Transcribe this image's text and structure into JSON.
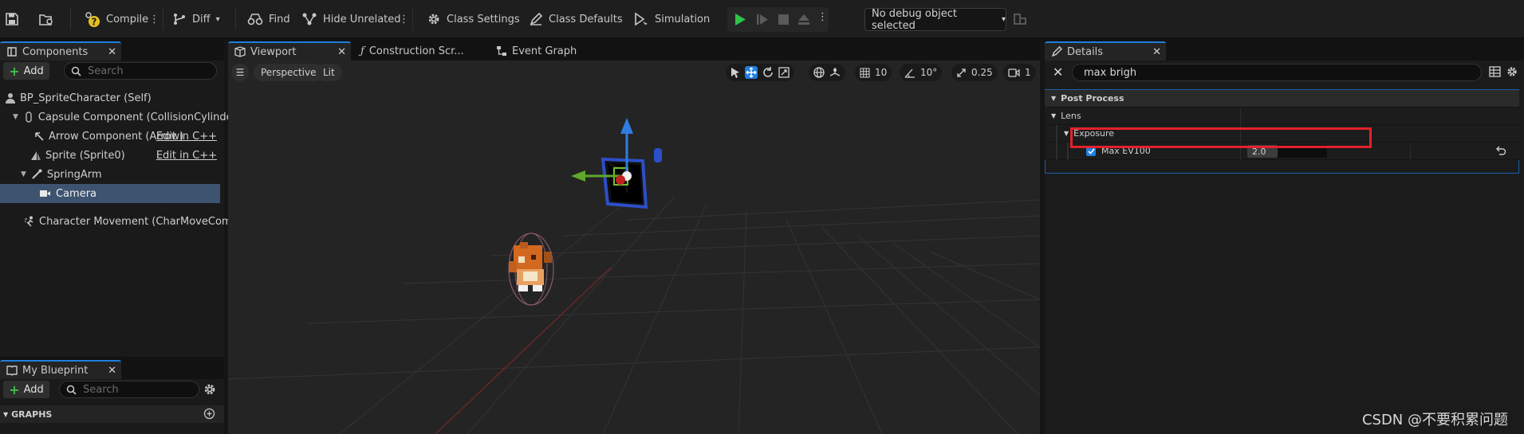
{
  "toolbar": {
    "compile_label": "Compile",
    "diff_label": "Diff",
    "find_label": "Find",
    "hide_unrelated_label": "Hide Unrelated",
    "class_settings_label": "Class Settings",
    "class_defaults_label": "Class Defaults",
    "simulation_label": "Simulation",
    "debug_object": "No debug object selected"
  },
  "components": {
    "tab_title": "Components",
    "add_label": "Add",
    "search_placeholder": "Search",
    "items": [
      {
        "label": "BP_SpriteCharacter (Self)"
      },
      {
        "label": "Capsule Component (CollisionCylinder)"
      },
      {
        "label": "Arrow Component (Arrow)",
        "link": "Edit in C++"
      },
      {
        "label": "Sprite (Sprite0)",
        "link": "Edit in C++"
      },
      {
        "label": "SpringArm"
      },
      {
        "label": "Camera"
      },
      {
        "label": "Character Movement (CharMoveComp)"
      }
    ]
  },
  "my_blueprint": {
    "tab_title": "My Blueprint",
    "add_label": "Add",
    "search_placeholder": "Search",
    "graphs_label": "GRAPHS"
  },
  "editor_tabs": {
    "viewport": "Viewport",
    "construction": "Construction Scr...",
    "event_graph": "Event Graph"
  },
  "viewport_toolbar": {
    "perspective": "Perspective",
    "lit": "Lit",
    "grid_snap": "10",
    "rotation_snap": "10°",
    "scale_snap": "0.25",
    "camera_speed": "1"
  },
  "details": {
    "tab_title": "Details",
    "search_value": "max brigh",
    "post_process": "Post Process",
    "lens": "Lens",
    "exposure": "Exposure",
    "property_label": "Max EV100",
    "property_value": "2.0",
    "property_checked": true
  },
  "watermark": "CSDN @不要积累问题",
  "colors": {
    "accent": "#1f7fe0",
    "play_green": "#2ec24a",
    "highlight_red": "#e3212b",
    "selected_row": "#3d5370"
  }
}
